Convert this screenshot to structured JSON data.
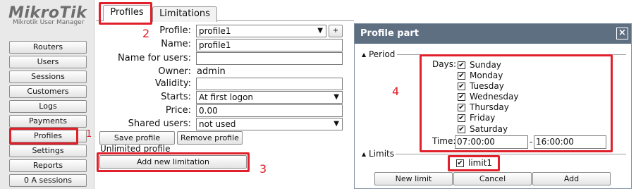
{
  "app": {
    "logo_main": "MikroTik",
    "logo_sub": "Mikrotik User Manager"
  },
  "sidebar": {
    "items": [
      {
        "label": "Routers"
      },
      {
        "label": "Users"
      },
      {
        "label": "Sessions"
      },
      {
        "label": "Customers"
      },
      {
        "label": "Logs"
      },
      {
        "label": "Payments"
      },
      {
        "label": "Profiles"
      },
      {
        "label": "Settings"
      },
      {
        "label": "Reports"
      },
      {
        "label": "0 A sessions"
      }
    ]
  },
  "tabs": [
    {
      "label": "Profiles"
    },
    {
      "label": "Limitations"
    }
  ],
  "form": {
    "profile_label": "Profile:",
    "profile_value": "profile1",
    "plus": "+",
    "name_label": "Name:",
    "name_value": "profile1",
    "name_for_users_label": "Name for users:",
    "name_for_users_value": "",
    "owner_label": "Owner:",
    "owner_value": "admin",
    "validity_label": "Validity:",
    "validity_value": "",
    "starts_label": "Starts:",
    "starts_value": "At first logon",
    "price_label": "Price:",
    "price_value": "0.00",
    "shared_users_label": "Shared users:",
    "shared_users_value": "not used",
    "save_profile": "Save profile",
    "remove_profile": "Remove profile",
    "unlimited_text": "Unlimited profile",
    "add_limitation": "Add new limitation"
  },
  "annotations": {
    "n1": "1",
    "n2": "2",
    "n3": "3",
    "n4": "4"
  },
  "dialog": {
    "title": "Profile part",
    "close": "×",
    "period_label": "Period",
    "days_label": "Days:",
    "days": [
      {
        "label": "Sunday",
        "checked": true
      },
      {
        "label": "Monday",
        "checked": true
      },
      {
        "label": "Tuesday",
        "checked": true
      },
      {
        "label": "Wednesday",
        "checked": true
      },
      {
        "label": "Thursday",
        "checked": true
      },
      {
        "label": "Friday",
        "checked": true
      },
      {
        "label": "Saturday",
        "checked": true
      }
    ],
    "time_label": "Time:",
    "time_from": "07:00:00",
    "time_sep": "-",
    "time_to": "16:00:00",
    "limits_label": "Limits",
    "limit_item": "limit1",
    "new_limit": "New limit",
    "cancel": "Cancel",
    "add": "Add"
  },
  "colors": {
    "annotation_red": "#e0202a",
    "dialog_header": "#5f6f82"
  }
}
